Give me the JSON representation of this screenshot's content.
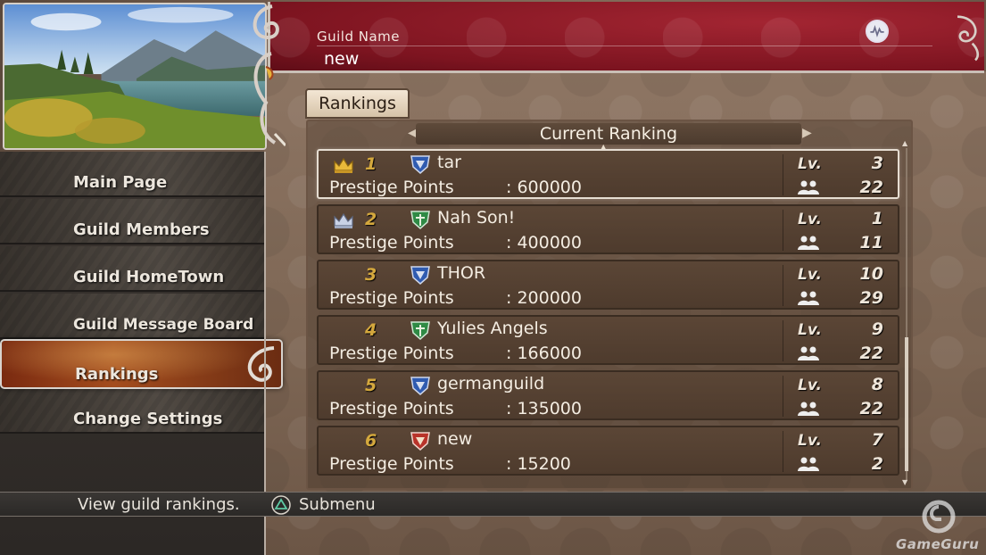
{
  "header": {
    "guild_name_label": "Guild Name",
    "guild_name_value": "new",
    "network_icon": "network-status-icon"
  },
  "menu": {
    "items": [
      {
        "label": "Main Page",
        "active": false
      },
      {
        "label": "Guild Members",
        "active": false
      },
      {
        "label": "Guild HomeTown",
        "active": false
      },
      {
        "label": "Guild Message Board",
        "active": false
      },
      {
        "label": "Rankings",
        "active": true
      },
      {
        "label": "Change Settings",
        "active": false
      }
    ]
  },
  "tab": {
    "label": "Rankings"
  },
  "subheader": {
    "label": "Current Ranking"
  },
  "rankings": [
    {
      "rank": "1",
      "crown": "gold-crown-icon",
      "emblem": "blue-emblem-icon",
      "name": "tar",
      "points_label": "Prestige Points",
      "points": ": 600000",
      "level_label": "Lv.",
      "level": "3",
      "members": "22"
    },
    {
      "rank": "2",
      "crown": "silver-crown-icon",
      "emblem": "green-emblem-icon",
      "name": "Nah Son!",
      "points_label": "Prestige Points",
      "points": ": 400000",
      "level_label": "Lv.",
      "level": "1",
      "members": "11"
    },
    {
      "rank": "3",
      "crown": "",
      "emblem": "blue-emblem-icon",
      "name": "THOR",
      "points_label": "Prestige Points",
      "points": ": 200000",
      "level_label": "Lv.",
      "level": "10",
      "members": "29"
    },
    {
      "rank": "4",
      "crown": "",
      "emblem": "green-emblem-icon",
      "name": "Yulies Angels",
      "points_label": "Prestige Points",
      "points": ": 166000",
      "level_label": "Lv.",
      "level": "9",
      "members": "22"
    },
    {
      "rank": "5",
      "crown": "",
      "emblem": "blue-emblem-icon",
      "name": "germanguild",
      "points_label": "Prestige Points",
      "points": ": 135000",
      "level_label": "Lv.",
      "level": "8",
      "members": "22"
    },
    {
      "rank": "6",
      "crown": "",
      "emblem": "red-emblem-icon",
      "name": "new",
      "points_label": "Prestige Points",
      "points": ": 15200",
      "level_label": "Lv.",
      "level": "7",
      "members": "2"
    }
  ],
  "helpbar": {
    "description": "View guild rankings.",
    "button_icon": "triangle-button-icon",
    "submenu_label": "Submenu"
  },
  "watermark": {
    "text": "GameGuru"
  },
  "colors": {
    "banner_red": "#8a1a26",
    "rank_gold": "#d4a83d",
    "active_menu": "#a44d1e"
  }
}
